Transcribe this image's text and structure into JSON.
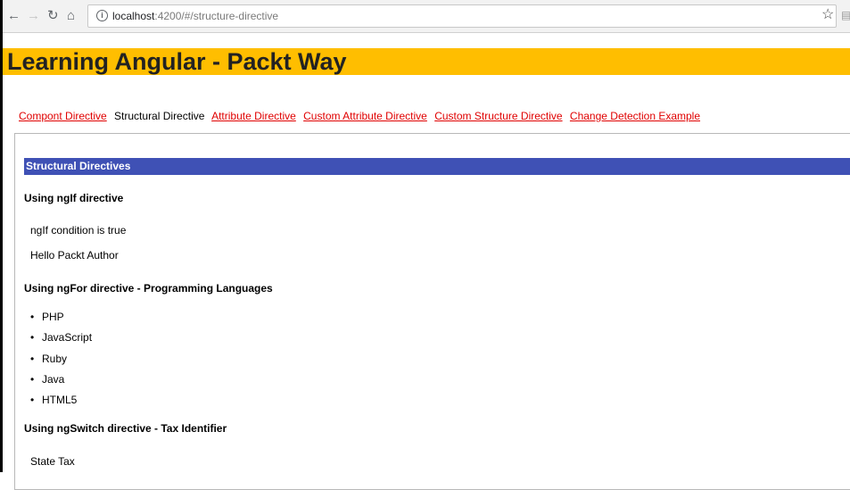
{
  "browser": {
    "url_host": "localhost",
    "url_path": ":4200/#/structure-directive",
    "back_icon": "arrow-left",
    "forward_icon": "arrow-right",
    "reload_icon": "reload",
    "home_icon": "home",
    "info_icon": "info",
    "star_icon": "star",
    "extension_icon": "extension"
  },
  "app": {
    "title": "Learning Angular - Packt Way",
    "banner_color": "#ffbe00"
  },
  "nav": {
    "items": [
      {
        "label": "Compont Directive",
        "active": false
      },
      {
        "label": "Structural Directive",
        "active": true
      },
      {
        "label": "Attribute Directive",
        "active": false
      },
      {
        "label": "Custom Attribute Directive",
        "active": false
      },
      {
        "label": "Custom Structure Directive",
        "active": false
      },
      {
        "label": "Change Detection Example",
        "active": false
      }
    ],
    "link_color": "#e00000"
  },
  "content": {
    "section_title": "Structural Directives",
    "section_color": "#3f51b5",
    "ngif": {
      "heading": "Using ngIf directive",
      "condition_text": "ngIf condition is true",
      "greeting": "Hello Packt Author"
    },
    "ngfor": {
      "heading": "Using ngFor directive - Programming Languages",
      "languages": [
        "PHP",
        "JavaScript",
        "Ruby",
        "Java",
        "HTML5"
      ]
    },
    "ngswitch": {
      "heading": "Using ngSwitch directive - Tax Identifier",
      "result": "State Tax"
    }
  }
}
